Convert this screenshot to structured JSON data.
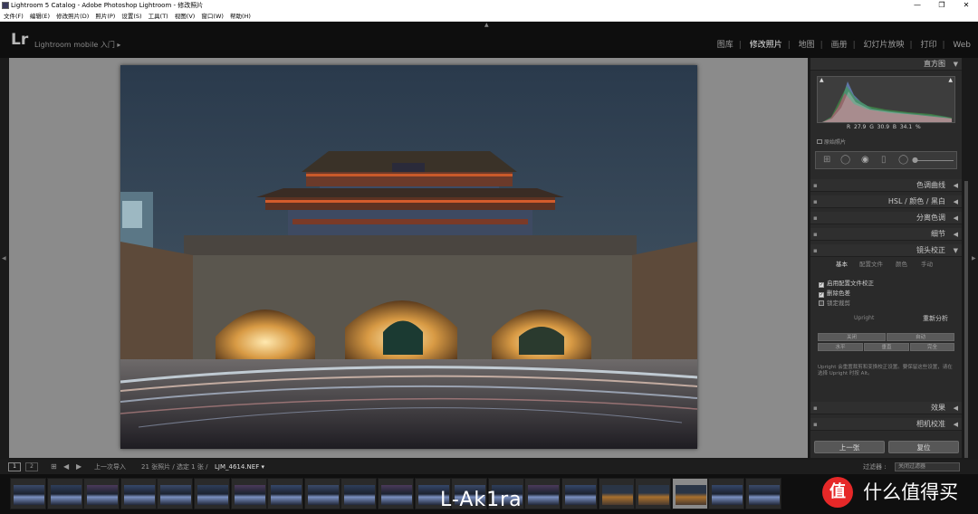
{
  "window": {
    "title": "Lightroom 5 Catalog - Adobe Photoshop Lightroom - 修改照片",
    "controls": {
      "minimize": "—",
      "maximize": "❐",
      "close": "✕"
    }
  },
  "menu": [
    "文件(F)",
    "编辑(E)",
    "修改照片(D)",
    "照片(P)",
    "设置(S)",
    "工具(T)",
    "视图(V)",
    "窗口(W)",
    "帮助(H)"
  ],
  "identity": {
    "logo": "Lr",
    "text": "Lightroom mobile 入门 ▸"
  },
  "modules": [
    "图库",
    "修改照片",
    "地图",
    "画册",
    "幻灯片放映",
    "打印",
    "Web"
  ],
  "right_panel": {
    "histogram_title": "直方图",
    "rgb": {
      "r_label": "R",
      "r": "27.9",
      "g_label": "G",
      "g": "30.9",
      "b_label": "B",
      "b": "34.1",
      "unit": "%"
    },
    "original_photo": "原始照片",
    "sections_top": [
      {
        "label": "色调曲线"
      },
      {
        "label": "HSL / 颜色 / 黑白"
      },
      {
        "label": "分离色调"
      },
      {
        "label": "细节"
      },
      {
        "label": "镜头校正"
      }
    ],
    "lens_tabs": [
      "基本",
      "配置文件",
      "颜色",
      "手动"
    ],
    "checkboxes": [
      {
        "label": "启用配置文件校正",
        "checked": true
      },
      {
        "label": "删除色差",
        "checked": true
      },
      {
        "label": "锁定裁剪",
        "checked": false
      }
    ],
    "upright_label": "Upright",
    "reanalyze": "重新分析",
    "upright_buttons_row1": [
      "关闭",
      "自动"
    ],
    "upright_buttons_row2": [
      "水平",
      "垂直",
      "完全"
    ],
    "upright_note": "Upright 会重置裁剪和变换校正设置。要保留这些设置，请在选择 Upright 时按 Alt。",
    "sections_bottom": [
      {
        "label": "效果"
      },
      {
        "label": "相机校准"
      }
    ],
    "prev_button": "上一张",
    "reset_button": "复位"
  },
  "filmstrip_bar": {
    "page1": "1",
    "page2": "2",
    "prev_import": "上一次导入",
    "count": "21 张照片 / 选定 1 张 /",
    "filename": "LJM_4614.NEF ▾",
    "filter_label": "过滤器 :",
    "filter_value": "关闭过滤器"
  },
  "filmstrip": {
    "count": 21,
    "selected_index": 18
  },
  "watermark": "L-Ak1ra",
  "brand": {
    "logo": "值",
    "text": "什么值得买"
  },
  "colors": {
    "accent": "#e8e8e8",
    "panel": "#2a2a2a",
    "brand_red": "#e62828"
  }
}
